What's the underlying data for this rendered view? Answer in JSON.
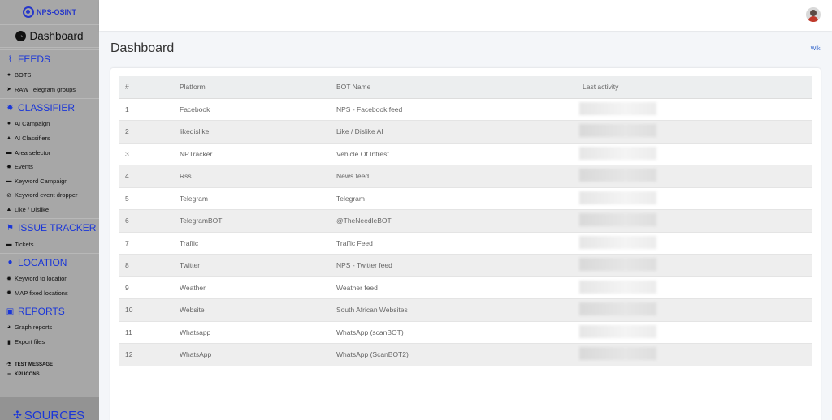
{
  "sidebar": {
    "logo": "NPS-OSINT",
    "dashboard": "Dashboard",
    "sections": [
      {
        "title": "FEEDS",
        "icon": "rss-icon",
        "items": [
          {
            "label": "BOTS",
            "icon": "robot-icon"
          },
          {
            "label": "RAW Telegram groups",
            "icon": "telegram-icon"
          }
        ]
      },
      {
        "title": "CLASSIFIER",
        "icon": "gear-icon",
        "items": [
          {
            "label": "AI Campaign",
            "icon": "brain-icon"
          },
          {
            "label": "AI Classifiers",
            "icon": "graduation-cap-icon"
          },
          {
            "label": "Area selector",
            "icon": "area-icon"
          },
          {
            "label": "Events",
            "icon": "burst-icon"
          },
          {
            "label": "Keyword Campaign",
            "icon": "briefcase-icon"
          },
          {
            "label": "Keyword event dropper",
            "icon": "slash-icon"
          },
          {
            "label": "Like / Dislike",
            "icon": "thumbs-up-icon"
          }
        ]
      },
      {
        "title": "ISSUE TRACKER",
        "icon": "flag-icon",
        "items": [
          {
            "label": "Tickets",
            "icon": "ticket-icon"
          }
        ]
      },
      {
        "title": "LOCATION",
        "icon": "map-pin-icon",
        "items": [
          {
            "label": "Keyword to location",
            "icon": "gear-icon"
          },
          {
            "label": "MAP fixed locations",
            "icon": "gear-icon"
          }
        ]
      },
      {
        "title": "REPORTS",
        "icon": "chart-icon",
        "items": [
          {
            "label": "Graph reports",
            "icon": "pie-icon"
          },
          {
            "label": "Export files",
            "icon": "file-icon"
          }
        ]
      }
    ],
    "extras": [
      {
        "label": "TEST MESSAGE",
        "icon": "flask-icon"
      },
      {
        "label": "KPI ICONS",
        "icon": "sliders-icon"
      }
    ],
    "sources": "SOURCES"
  },
  "header": {
    "title": "Dashboard",
    "wiki": "Wiki"
  },
  "table": {
    "columns": [
      "#",
      "Platform",
      "BOT Name",
      "Last activity"
    ],
    "rows": [
      [
        "1",
        "Facebook",
        "NPS - Facebook feed"
      ],
      [
        "2",
        "likedislike",
        "Like / Dislike AI"
      ],
      [
        "3",
        "NPTracker",
        "Vehicle Of Intrest"
      ],
      [
        "4",
        "Rss",
        "News feed"
      ],
      [
        "5",
        "Telegram",
        "Telegram"
      ],
      [
        "6",
        "TelegramBOT",
        "@TheNeedleBOT"
      ],
      [
        "7",
        "Traffic",
        "Traffic Feed"
      ],
      [
        "8",
        "Twitter",
        "NPS - Twitter feed"
      ],
      [
        "9",
        "Weather",
        "Weather feed"
      ],
      [
        "10",
        "Website",
        "South African Websites"
      ],
      [
        "11",
        "Whatsapp",
        "WhatsApp (scanBOT)"
      ],
      [
        "12",
        "WhatsApp",
        "WhatsApp (ScanBOT2)"
      ]
    ]
  }
}
